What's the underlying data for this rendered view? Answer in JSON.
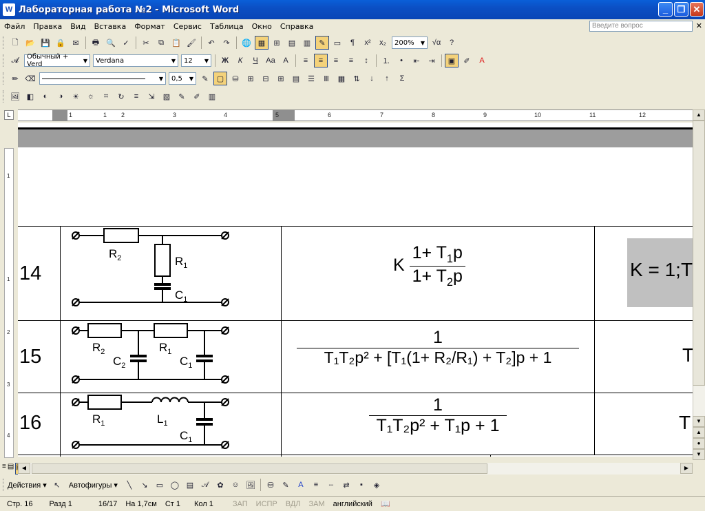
{
  "window": {
    "title": "Лабораторная работа №2 - Microsoft Word",
    "app_icon": "W"
  },
  "menu": [
    "Файл",
    "Правка",
    "Вид",
    "Вставка",
    "Формат",
    "Сервис",
    "Таблица",
    "Окно",
    "Справка"
  ],
  "help_box": {
    "placeholder": "Введите вопрос"
  },
  "toolbar": {
    "zoom": "200%"
  },
  "format_bar": {
    "style": "Обычный + Verd",
    "font": "Verdana",
    "size": "12"
  },
  "drawing_line": {
    "weight": "0,5"
  },
  "ruler": {
    "ticks": [
      "1",
      "1",
      "2",
      "3",
      "4",
      "5",
      "6",
      "7",
      "8",
      "9",
      "10",
      "11",
      "12"
    ]
  },
  "vruler": {
    "ticks": [
      "1",
      "1",
      "2",
      "3",
      "4"
    ]
  },
  "table": {
    "rows": [
      {
        "num": "14",
        "labels": {
          "r2": "R",
          "r2s": "2",
          "r1": "R",
          "r1s": "1",
          "c1": "C",
          "c1s": "1"
        },
        "formula": {
          "k": "K",
          "num": "1+ T",
          "num_sub": "1",
          "num_tail": "p",
          "den": "1+ T",
          "den_sub": "2",
          "den_tail": "p"
        },
        "param": "K = 1;T"
      },
      {
        "num": "15",
        "labels": {
          "r2": "R",
          "r2s": "2",
          "r1": "R",
          "r1s": "1",
          "c2": "C",
          "c2s": "2",
          "c1": "C",
          "c1s": "1"
        },
        "formula": {
          "num": "1",
          "den": "T₁T₂p² + [T₁(1+ R₂/R₁) + T₂]p + 1"
        },
        "param": "T"
      },
      {
        "num": "16",
        "labels": {
          "r1": "R",
          "r1s": "1",
          "l1": "L",
          "l1s": "1",
          "c1": "C",
          "c1s": "1"
        },
        "formula": {
          "num": "1",
          "den": "T₁T₂p² + T₁p + 1"
        },
        "param": "T"
      }
    ],
    "next_row_partial": "R"
  },
  "drawbar": {
    "actions": "Действия",
    "autoshapes": "Автофигуры"
  },
  "status": {
    "page": "Стр. 16",
    "section": "Разд 1",
    "pages": "16/17",
    "at": "На 1,7см",
    "line": "Ст 1",
    "col": "Кол 1",
    "rec": "ЗАП",
    "trk": "ИСПР",
    "ext": "ВДЛ",
    "ovr": "ЗАМ",
    "lang": "английский"
  }
}
